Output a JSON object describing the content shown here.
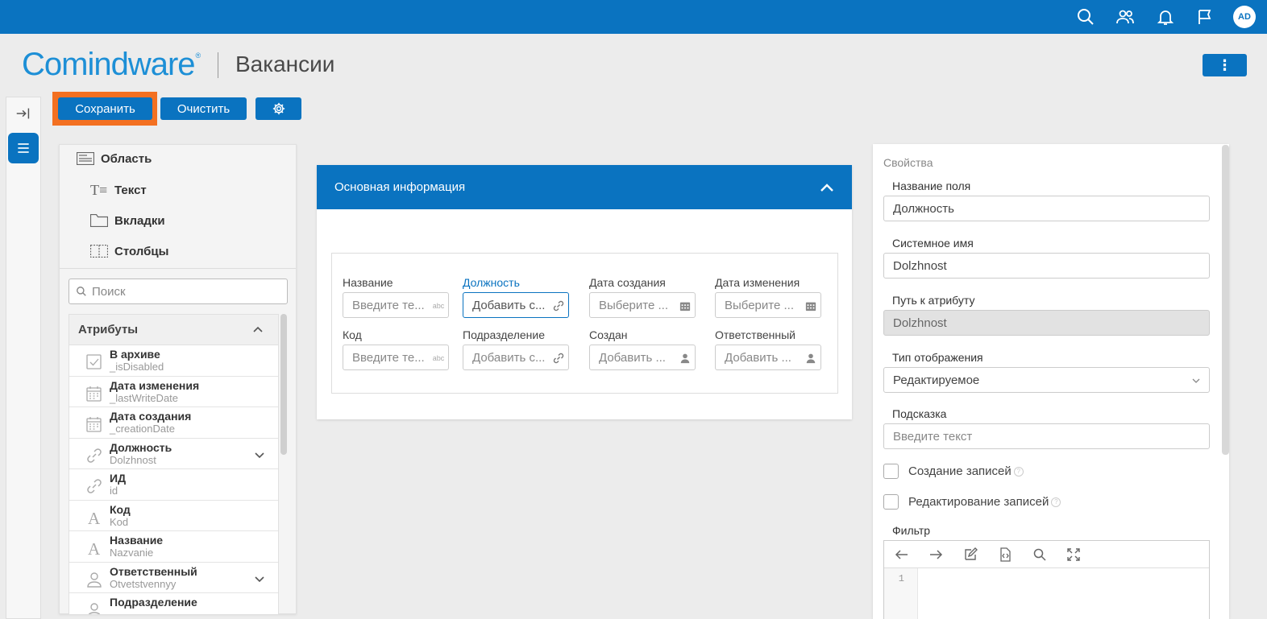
{
  "topbar": {
    "icons": [
      "search-icon",
      "users-icon",
      "bell-icon",
      "flag-icon"
    ],
    "avatar_initials": "AD",
    "brand_color": "#0a73c0"
  },
  "header": {
    "logo_text": "Comindware",
    "logo_mark": "®",
    "title": "Вакансии",
    "menu_icon": "kebab-icon"
  },
  "toolbar": {
    "save_label": "Сохранить",
    "clear_label": "Очистить",
    "settings_icon": "gear-icon",
    "highlight_color": "#f37021"
  },
  "left_panel": {
    "tools": [
      {
        "label": "Область",
        "icon": "area-icon"
      },
      {
        "label": "Текст",
        "icon": "text-icon"
      },
      {
        "label": "Вкладки",
        "icon": "tabs-icon"
      },
      {
        "label": "Столбцы",
        "icon": "columns-icon"
      }
    ],
    "search_placeholder": "Поиск",
    "attributes_title": "Атрибуты",
    "attributes": [
      {
        "name": "В архиве",
        "system": "_isDisabled",
        "icon": "checkbox-icon",
        "expandable": false
      },
      {
        "name": "Дата изменения",
        "system": "_lastWriteDate",
        "icon": "calendar-icon",
        "expandable": false
      },
      {
        "name": "Дата создания",
        "system": "_creationDate",
        "icon": "calendar-icon",
        "expandable": false
      },
      {
        "name": "Должность",
        "system": "Dolzhnost",
        "icon": "link-icon",
        "expandable": true
      },
      {
        "name": "ИД",
        "system": "id",
        "icon": "link-icon",
        "expandable": false
      },
      {
        "name": "Код",
        "system": "Kod",
        "icon": "text-a-icon",
        "expandable": false
      },
      {
        "name": "Название",
        "system": "Nazvanie",
        "icon": "text-a-icon",
        "expandable": false
      },
      {
        "name": "Ответственный",
        "system": "Otvetstvennyy",
        "icon": "user-icon",
        "expandable": true
      },
      {
        "name": "Подразделение",
        "system": "",
        "icon": "user-icon",
        "expandable": false
      }
    ]
  },
  "form": {
    "section_title": "Основная информация",
    "fields": [
      {
        "label": "Название",
        "placeholder": "Введите те...",
        "icon": "abc-icon",
        "active": false
      },
      {
        "label": "Должность",
        "placeholder": "Добавить с...",
        "icon": "link-icon",
        "active": true
      },
      {
        "label": "Дата создания",
        "placeholder": "Выберите ...",
        "icon": "calendar-icon",
        "active": false
      },
      {
        "label": "Дата изменения",
        "placeholder": "Выберите ...",
        "icon": "calendar-icon",
        "active": false
      },
      {
        "label": "Код",
        "placeholder": "Введите те...",
        "icon": "abc-icon",
        "active": false
      },
      {
        "label": "Подразделение",
        "placeholder": "Добавить с...",
        "icon": "link-icon",
        "active": false
      },
      {
        "label": "Создан",
        "placeholder": "Добавить ...",
        "icon": "user-icon",
        "active": false
      },
      {
        "label": "Ответственный",
        "placeholder": "Добавить ...",
        "icon": "user-icon",
        "active": false
      }
    ],
    "abc_text": "abc"
  },
  "properties": {
    "section_title": "Свойства",
    "field_name_label": "Название поля",
    "field_name_value": "Должность",
    "system_name_label": "Системное имя",
    "system_name_value": "Dolzhnost",
    "path_label": "Путь к атрибуту",
    "path_value": "Dolzhnost",
    "display_type_label": "Тип отображения",
    "display_type_value": "Редактируемое",
    "hint_label": "Подсказка",
    "hint_placeholder": "Введите текст",
    "create_records_label": "Создание записей",
    "edit_records_label": "Редактирование записей",
    "help_glyph": "?",
    "filter_label": "Фильтр",
    "editor_line_number": "1",
    "editor_icons": [
      "undo-icon",
      "redo-icon",
      "edit-icon",
      "code-file-icon",
      "search-icon",
      "expand-icon"
    ]
  }
}
